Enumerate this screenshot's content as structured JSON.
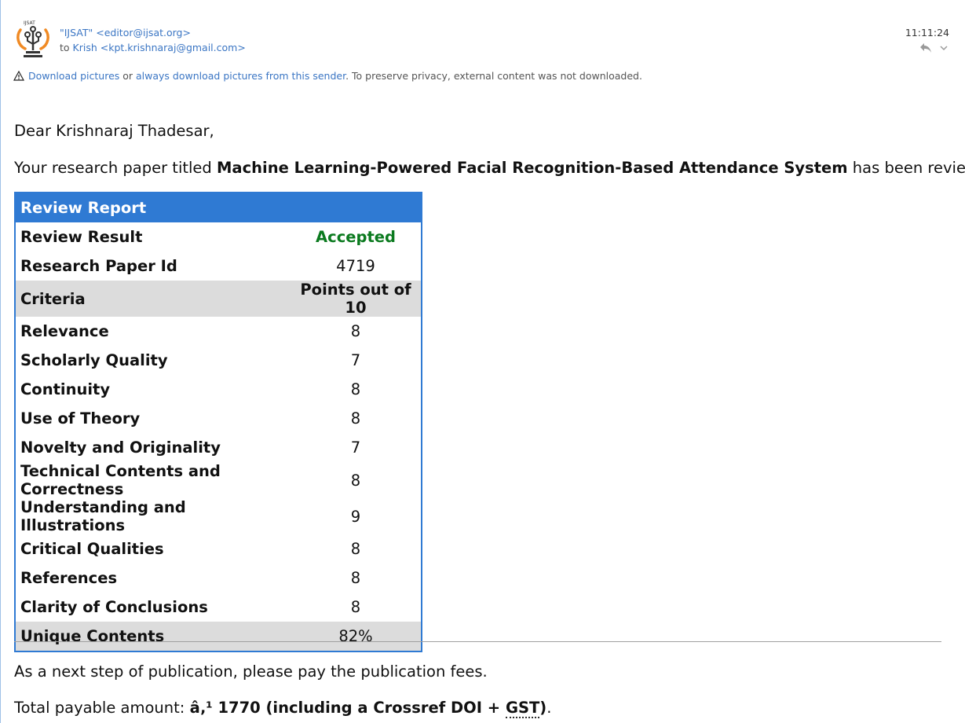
{
  "header": {
    "sender_display": "\"IJSAT\" <editor@ijsat.org>",
    "to_label": "to",
    "to_name": "Krish",
    "to_address": "<kpt.krishnaraj@gmail.com>",
    "time": "11:11:24",
    "logo_text": "IJSAT"
  },
  "notice": {
    "link1": "Download pictures",
    "or": " or ",
    "link2": "always download pictures from this sender",
    "rest": ". To preserve privacy, external content was not downloaded."
  },
  "body": {
    "greeting": "Dear Krishnaraj Thadesar,",
    "intro_prefix": "Your research paper titled ",
    "paper_title": "Machine Learning-Powered Facial Recognition-Based Attendance System",
    "intro_suffix": " has been reviewed."
  },
  "report": {
    "title": "Review Report",
    "result_label": "Review Result",
    "result_value": "Accepted",
    "id_label": "Research Paper Id",
    "id_value": "4719",
    "criteria_header": "Criteria",
    "points_header": "Points out of 10",
    "rows": [
      {
        "label": "Relevance",
        "value": "8"
      },
      {
        "label": "Scholarly Quality",
        "value": "7"
      },
      {
        "label": "Continuity",
        "value": "8"
      },
      {
        "label": "Use of Theory",
        "value": "8"
      },
      {
        "label": "Novelty and Originality",
        "value": "7"
      },
      {
        "label": "Technical Contents and Correctness",
        "value": "8"
      },
      {
        "label": "Understanding and Illustrations",
        "value": "9"
      },
      {
        "label": "Critical Qualities",
        "value": "8"
      },
      {
        "label": "References",
        "value": "8"
      },
      {
        "label": "Clarity of Conclusions",
        "value": "8"
      }
    ],
    "unique_label": "Unique Contents",
    "unique_value": "82%"
  },
  "footer": {
    "next_step": "As a next step of publication, please pay the publication fees.",
    "payable_prefix": "Total payable amount: ",
    "amount": "â‚¹ 1770 (including a Crossref DOI + ",
    "gst": "GST",
    "close_paren": ")",
    "period": "."
  },
  "colors": {
    "accent": "#2f7ad3",
    "link": "#3b76c4",
    "accepted": "#0b7a1f",
    "shade": "#dcdcdc"
  },
  "icons": [
    "ijsat-logo-icon",
    "reply-icon",
    "chevron-down-icon",
    "warning-icon"
  ]
}
